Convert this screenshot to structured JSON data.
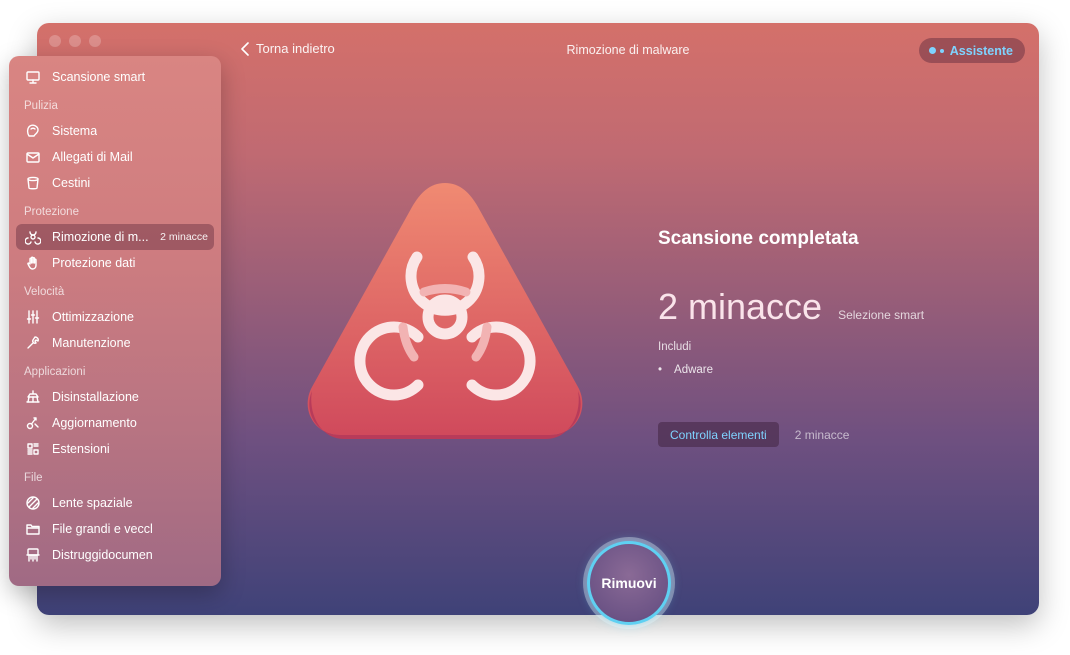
{
  "window": {
    "title": "Rimozione di malware"
  },
  "nav": {
    "back_label": "Torna indietro"
  },
  "assistant": {
    "label": "Assistente",
    "accent": "#7fd3ff"
  },
  "sidebar": {
    "top_item": {
      "label": "Scansione smart",
      "icon": "monitor-icon"
    },
    "sections": [
      {
        "title": "Pulizia",
        "items": [
          {
            "label": "Sistema",
            "icon": "disc-icon"
          },
          {
            "label": "Allegati di Mail",
            "icon": "mail-icon"
          },
          {
            "label": "Cestini",
            "icon": "trash-icon"
          }
        ]
      },
      {
        "title": "Protezione",
        "items": [
          {
            "label": "Rimozione di m...",
            "icon": "biohazard-icon",
            "badge": "2 minacce",
            "active": true
          },
          {
            "label": "Protezione dati",
            "icon": "hand-icon"
          }
        ]
      },
      {
        "title": "Velocità",
        "items": [
          {
            "label": "Ottimizzazione",
            "icon": "sliders-icon"
          },
          {
            "label": "Manutenzione",
            "icon": "wrench-icon"
          }
        ]
      },
      {
        "title": "Applicazioni",
        "items": [
          {
            "label": "Disinstallazione",
            "icon": "uninstall-icon"
          },
          {
            "label": "Aggiornamento",
            "icon": "update-icon"
          },
          {
            "label": "Estensioni",
            "icon": "extensions-icon"
          }
        ]
      },
      {
        "title": "File",
        "items": [
          {
            "label": "Lente spaziale",
            "icon": "space-lens-icon"
          },
          {
            "label": "File grandi e vecchi",
            "icon": "folder-icon"
          },
          {
            "label": "Distruggidocumenti",
            "icon": "shredder-icon"
          }
        ]
      }
    ]
  },
  "result": {
    "title": "Scansione completata",
    "count": "2 minacce",
    "smart_label": "Selezione smart",
    "includes_label": "Includi",
    "includes": [
      "Adware"
    ],
    "review_button": "Controlla elementi",
    "review_count": "2 minacce"
  },
  "action": {
    "remove_label": "Rimuovi"
  },
  "colors": {
    "hero_top": "#f08a72",
    "hero_bottom": "#d04a5c",
    "remove_ring": "#5fd0f2"
  }
}
